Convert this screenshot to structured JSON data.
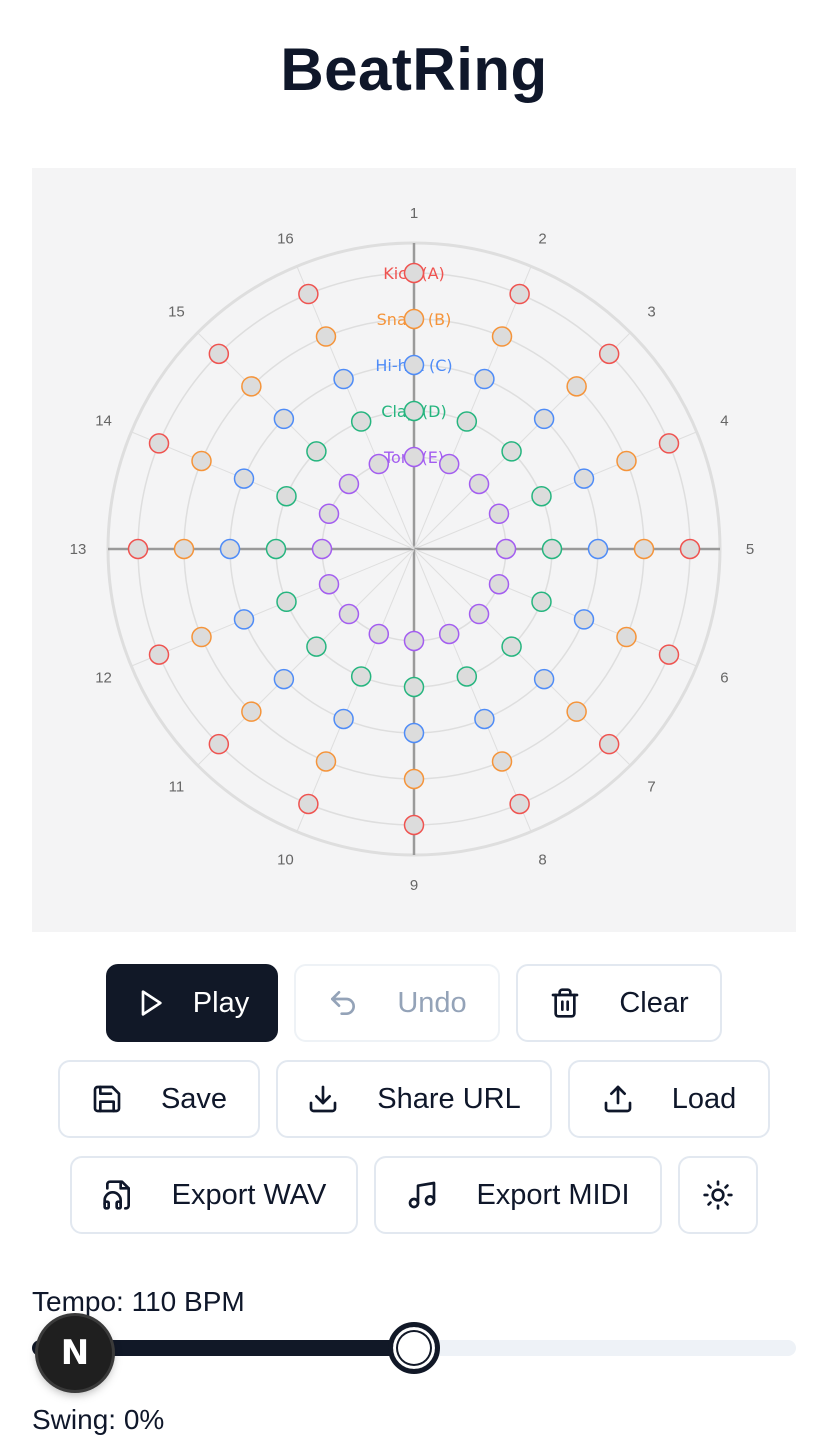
{
  "app": {
    "title": "BeatRing"
  },
  "ring": {
    "steps": 16,
    "step_labels": [
      "1",
      "2",
      "3",
      "4",
      "5",
      "6",
      "7",
      "8",
      "9",
      "10",
      "11",
      "12",
      "13",
      "14",
      "15",
      "16"
    ],
    "tracks": [
      {
        "name": "Kick (A)",
        "color": "#ef5350"
      },
      {
        "name": "Snare (B)",
        "color": "#f5943a"
      },
      {
        "name": "Hi-hat (C)",
        "color": "#4f8cf7"
      },
      {
        "name": "Clap (D)",
        "color": "#26b57f"
      },
      {
        "name": "Tom (E)",
        "color": "#a35df0"
      }
    ],
    "active_steps": [
      [],
      [],
      [],
      [],
      []
    ],
    "colors": {
      "panel": "#f4f4f5",
      "grid": "#dedede",
      "axis": "#9a9a9a",
      "step_fill": "#dcdcdc",
      "label": "#666666"
    }
  },
  "toolbar": {
    "play": {
      "label": "Play",
      "icon": "play-icon"
    },
    "undo": {
      "label": "Undo",
      "icon": "undo-icon",
      "disabled": true
    },
    "clear": {
      "label": "Clear",
      "icon": "trash-icon"
    },
    "save": {
      "label": "Save",
      "icon": "save-icon"
    },
    "share": {
      "label": "Share URL",
      "icon": "download-icon"
    },
    "load": {
      "label": "Load",
      "icon": "upload-icon"
    },
    "export_wav": {
      "label": "Export WAV",
      "icon": "file-audio-icon"
    },
    "export_midi": {
      "label": "Export MIDI",
      "icon": "music-icon"
    },
    "theme": {
      "icon": "sun-icon"
    }
  },
  "tempo": {
    "label": "Tempo: 110 BPM",
    "value": 110,
    "min": 40,
    "max": 180
  },
  "swing": {
    "label": "Swing: 0%"
  },
  "overlay": {
    "badge_letter": "N"
  }
}
